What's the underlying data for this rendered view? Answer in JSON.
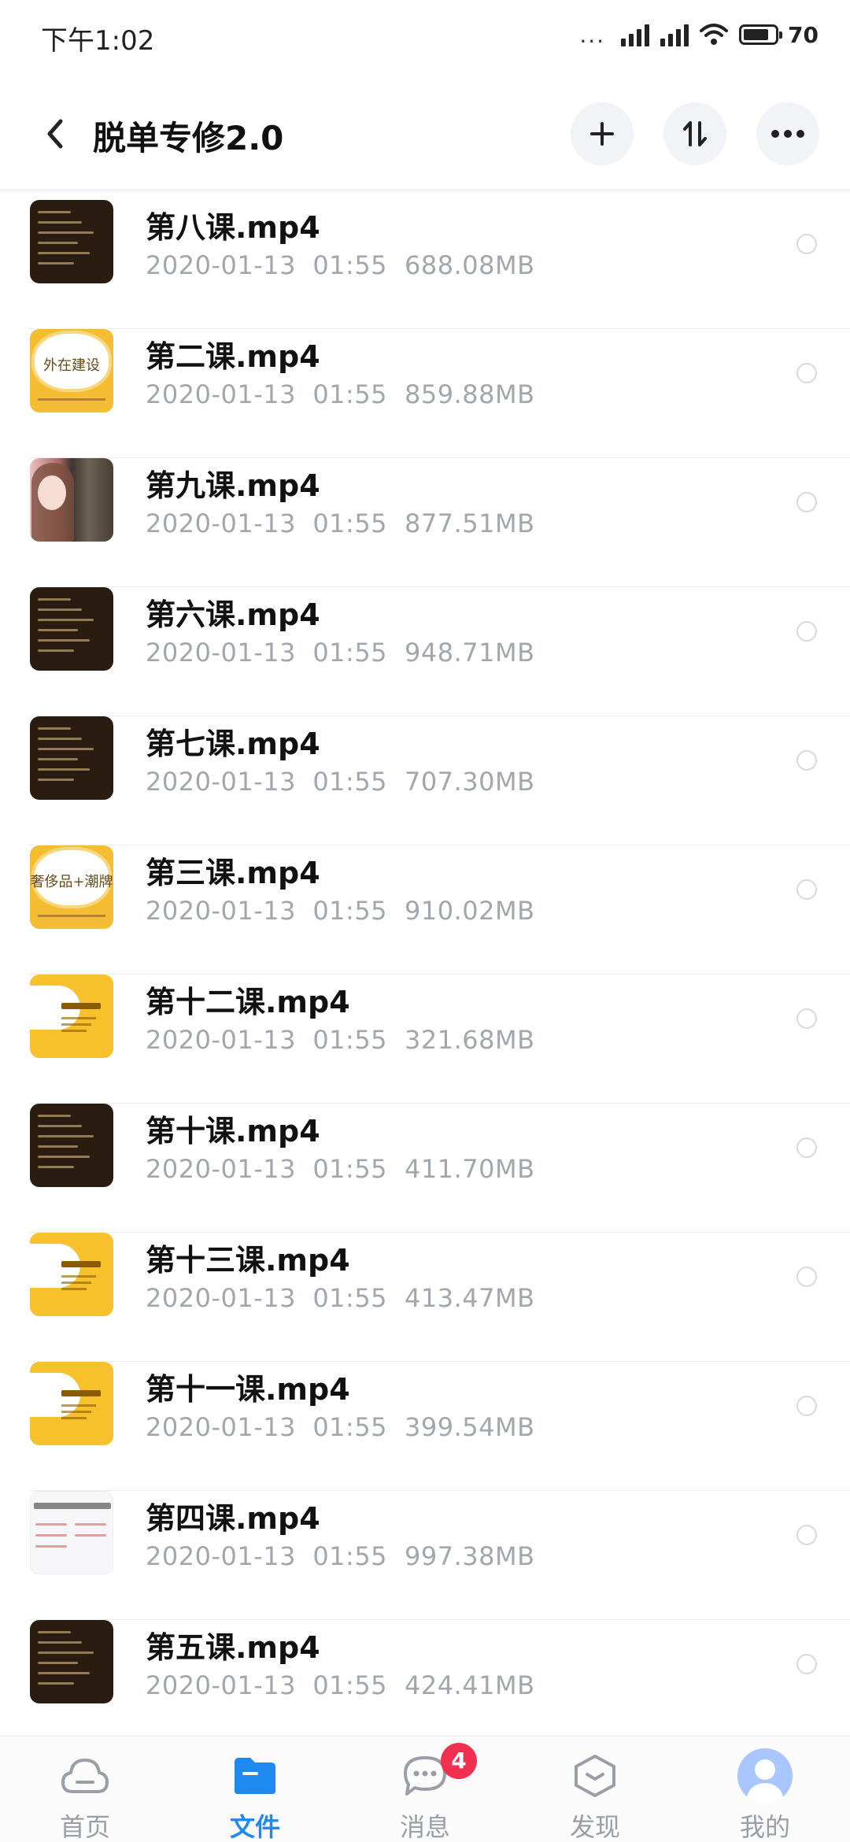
{
  "status_bar": {
    "time": "下午1:02",
    "dots": "...",
    "battery_level": "70",
    "battery_fraction": 0.7
  },
  "header": {
    "title": "脱单专修2.0",
    "back_icon": "chevron-left-icon",
    "actions": [
      "add-icon",
      "sort-icon",
      "more-icon"
    ]
  },
  "files": [
    {
      "name": "第八课.mp4",
      "date": "2020-01-13  01:55",
      "size": "688.08MB",
      "thumb": "dark"
    },
    {
      "name": "第二课.mp4",
      "date": "2020-01-13  01:55",
      "size": "859.88MB",
      "thumb": "gold",
      "thumb_text": "外在建设"
    },
    {
      "name": "第九课.mp4",
      "date": "2020-01-13  01:55",
      "size": "877.51MB",
      "thumb": "photo"
    },
    {
      "name": "第六课.mp4",
      "date": "2020-01-13  01:55",
      "size": "948.71MB",
      "thumb": "dark"
    },
    {
      "name": "第七课.mp4",
      "date": "2020-01-13  01:55",
      "size": "707.30MB",
      "thumb": "dark"
    },
    {
      "name": "第三课.mp4",
      "date": "2020-01-13  01:55",
      "size": "910.02MB",
      "thumb": "gold",
      "thumb_text": "奢侈品+潮牌"
    },
    {
      "name": "第十二课.mp4",
      "date": "2020-01-13  01:55",
      "size": "321.68MB",
      "thumb": "yellow"
    },
    {
      "name": "第十课.mp4",
      "date": "2020-01-13  01:55",
      "size": "411.70MB",
      "thumb": "dark"
    },
    {
      "name": "第十三课.mp4",
      "date": "2020-01-13  01:55",
      "size": "413.47MB",
      "thumb": "yellow"
    },
    {
      "name": "第十一课.mp4",
      "date": "2020-01-13  01:55",
      "size": "399.54MB",
      "thumb": "yellow"
    },
    {
      "name": "第四课.mp4",
      "date": "2020-01-13  01:55",
      "size": "997.38MB",
      "thumb": "light"
    },
    {
      "name": "第五课.mp4",
      "date": "2020-01-13  01:55",
      "size": "424.41MB",
      "thumb": "dark"
    }
  ],
  "nav": {
    "home": "首页",
    "files": "文件",
    "messages": "消息",
    "messages_badge": "4",
    "discover": "发现",
    "mine": "我的",
    "active": "files",
    "active_color": "#1e89f0",
    "badge_color": "#f0304e"
  }
}
